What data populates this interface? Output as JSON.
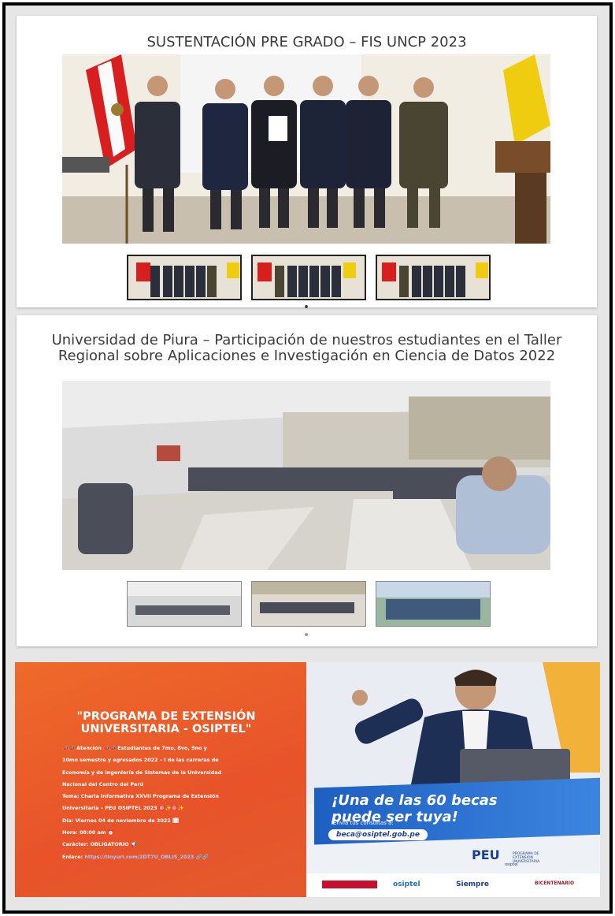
{
  "card1": {
    "title": "SUSTENTACIÓN PRE GRADO – FIS UNCP 2023",
    "photo_alt": "graduation-group-photo"
  },
  "card2": {
    "title": "Universidad de Piura – Participación de nuestros estudiantes en el Taller Regional sobre Aplicaciones e Investigación en Ciencia de Datos 2022",
    "photo_alt": "classroom-photo"
  },
  "banner": {
    "title": "\"PROGRAMA DE EXTENSIÓN UNIVERSITARIA - OSIPTEL\"",
    "lines": [
      "📣📣 Atención 📣📣 Estudiantes de 7mo, 8vo, 9no y",
      "10mo semestre y egresados 2022 – I de las carreras de",
      "Economía y de Ingeniería de Sistemas de la Universidad",
      "Nacional del Centro del Perú",
      "Tema: Charla Informativa XXVII Programa de Extensión",
      "Universitaria – PEU OSIPTEL 2023 🎯✨🎯✨",
      "Día: Viernes 04 de noviembre de 2022 🗓",
      "Hora: 08:00 am ⏰",
      "Carácter: OBLIGATORIO 📢"
    ],
    "link_label": "Enlace:",
    "link_text": "https://tinyurl.com/2DT7U_OBLIS_2023 🔗🔗",
    "headline_1": "¡Una de las 60 becas",
    "headline_2": "puede ser tuya!",
    "consult": "Envía tus consultas a:",
    "email": "beca@osiptel.gob.pe",
    "peu": "PEU",
    "peu_sub": "PROGRAMA DE EXTENSIÓN UNIVERSITARIA",
    "osiptel_small": "osiptel",
    "footer_osiptel": "osiptel",
    "footer_siempre": "Siempre",
    "footer_bicentenario": "BICENTENARIO"
  }
}
